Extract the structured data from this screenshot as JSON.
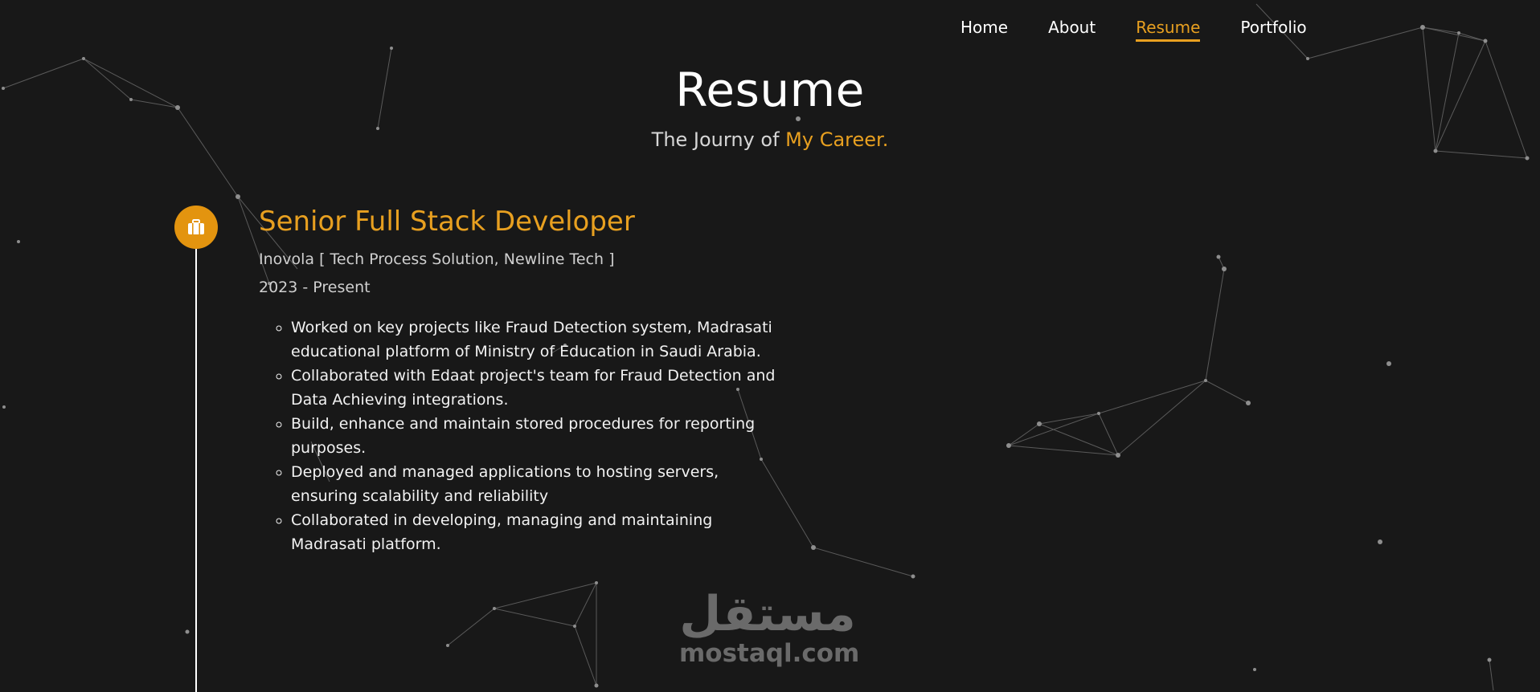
{
  "nav": {
    "items": [
      {
        "label": "Home",
        "active": false
      },
      {
        "label": "About",
        "active": false
      },
      {
        "label": "Resume",
        "active": true
      },
      {
        "label": "Portfolio",
        "active": false
      }
    ]
  },
  "hero": {
    "title": "Resume",
    "subtitle_prefix": "The Journy of ",
    "subtitle_highlight": "My Career."
  },
  "timeline": {
    "entries": [
      {
        "icon": "briefcase-icon",
        "title": "Senior Full Stack Developer",
        "company": "Inovola [ Tech Process Solution, Newline Tech ]",
        "period": "2023 - Present",
        "duties": [
          "Worked on key projects like Fraud Detection system, Madrasati educational platform of Ministry of Education in Saudi Arabia.",
          "Collaborated with Edaat project's team for Fraud Detection and Data Achieving integrations.",
          "Build, enhance and maintain stored procedures for reporting purposes.",
          "Deployed and managed applications to hosting servers, ensuring scalability and reliability",
          "Collaborated in developing, managing and maintaining Madrasati platform."
        ]
      }
    ]
  },
  "watermark": {
    "arabic": "مستقل",
    "latin": "mostaql.com"
  },
  "colors": {
    "background": "#181818",
    "accent": "#e8a020",
    "badge": "#e3940f",
    "text": "#ffffff"
  }
}
